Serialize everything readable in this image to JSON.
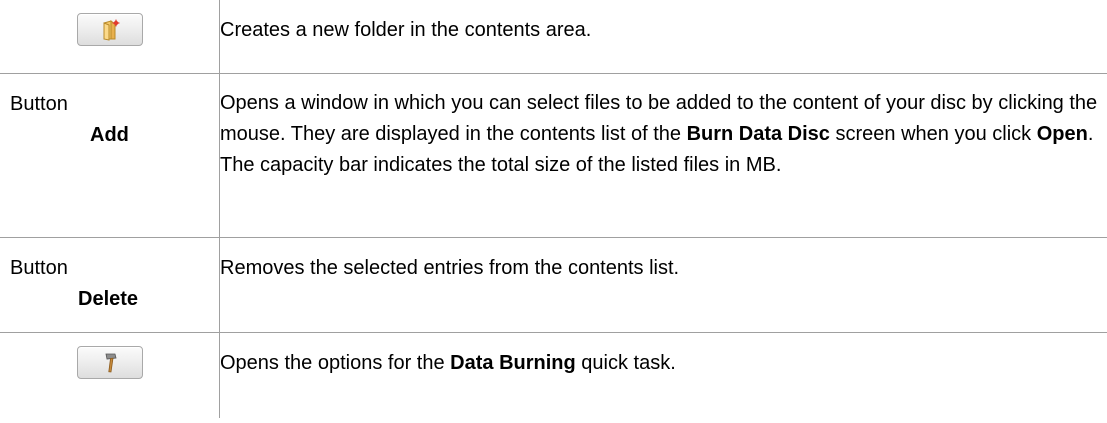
{
  "rows": [
    {
      "icon": "new-folder-icon",
      "description": "Creates a new folder in the contents area."
    },
    {
      "type": "Button",
      "name": "Add",
      "description": {
        "t1": "Opens a window in which you can select files to be added to the content of your disc by clicking the mouse. They are displayed in the contents list of the ",
        "b1": "Burn Data Disc",
        "t2": " screen when you click ",
        "b2": "Open",
        "t3": ". The capacity bar indicates the total size of the listed files in MB."
      }
    },
    {
      "type": "Button",
      "name": "Delete",
      "description": "Removes the selected entries from the contents list."
    },
    {
      "icon": "hammer-icon",
      "description": {
        "t1": "Opens the options for the ",
        "b1": "Data Burning",
        "t2": " quick task."
      }
    }
  ],
  "colors": {
    "border": "#a0a0a0",
    "text": "#000000",
    "folder": "#f0c060",
    "hammer_handle": "#c68a3a",
    "hammer_head": "#8a8a8a"
  }
}
